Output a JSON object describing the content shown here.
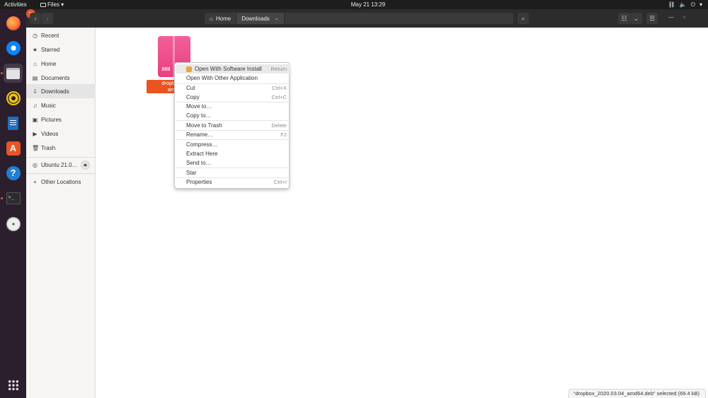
{
  "topbar": {
    "activities": "Activities",
    "app_name": "Files ▾",
    "clock": "May 21  13:29"
  },
  "dock": {
    "items": [
      {
        "name": "firefox",
        "icon": "firefox-icon"
      },
      {
        "name": "thunderbird",
        "icon": "thunderbird-icon"
      },
      {
        "name": "files",
        "icon": "files-icon"
      },
      {
        "name": "rhythmbox",
        "icon": "rhythmbox-icon"
      },
      {
        "name": "libreoffice-writer",
        "icon": "writer-icon"
      },
      {
        "name": "ubuntu-software",
        "icon": "software-icon"
      },
      {
        "name": "help",
        "icon": "help-icon"
      },
      {
        "name": "terminal",
        "icon": "terminal-icon"
      },
      {
        "name": "disc",
        "icon": "disc-icon"
      }
    ],
    "store_glyph": "A",
    "help_glyph": "?",
    "terminal_glyph": ">_",
    "show_apps_icon": "grid-icon"
  },
  "header": {
    "back": "‹",
    "forward": "›",
    "path": [
      {
        "label": "Home",
        "icon": "home-icon"
      },
      {
        "label": "Downloads",
        "icon": "chevron-down-icon"
      }
    ],
    "search_icon": "🔍",
    "view_icon": "☷",
    "view_dd": "⌄",
    "menu_icon": "☰",
    "minimize": "—",
    "maximize": "▫",
    "close": "✕"
  },
  "sidebar": {
    "items": [
      {
        "label": "Recent",
        "icon": "◷"
      },
      {
        "label": "Starred",
        "icon": "★"
      },
      {
        "label": "Home",
        "icon": "⌂"
      },
      {
        "label": "Documents",
        "icon": "▤"
      },
      {
        "label": "Downloads",
        "icon": "⇩"
      },
      {
        "label": "Music",
        "icon": "♫"
      },
      {
        "label": "Pictures",
        "icon": "▣"
      },
      {
        "label": "Videos",
        "icon": "▶"
      },
      {
        "label": "Trash",
        "icon": "🗑"
      }
    ],
    "device": {
      "label": "Ubuntu 21.0…",
      "icon": "◎",
      "eject": "⏏"
    },
    "other": {
      "label": "Other Locations",
      "icon": "+"
    }
  },
  "content": {
    "file": {
      "label_line1": "dropbox_2",
      "label_line2": "amd6"
    }
  },
  "context_menu": {
    "items": [
      {
        "label": "Open With Software Install",
        "accel": "Return"
      },
      {
        "label": "Open With Other Application",
        "accel": ""
      },
      {
        "label": "Cut",
        "accel": "Ctrl+X"
      },
      {
        "label": "Copy",
        "accel": "Ctrl+C"
      },
      {
        "label": "Move to…",
        "accel": ""
      },
      {
        "label": "Copy to…",
        "accel": ""
      },
      {
        "label": "Move to Trash",
        "accel": "Delete"
      },
      {
        "label": "Rename…",
        "accel": "F2"
      },
      {
        "label": "Compress…",
        "accel": ""
      },
      {
        "label": "Extract Here",
        "accel": ""
      },
      {
        "label": "Send to…",
        "accel": ""
      },
      {
        "label": "Star",
        "accel": ""
      },
      {
        "label": "Properties",
        "accel": "Ctrl+I"
      }
    ]
  },
  "status": {
    "text": "“dropbox_2020.03.04_amd64.deb” selected  (69.4 kB)"
  }
}
